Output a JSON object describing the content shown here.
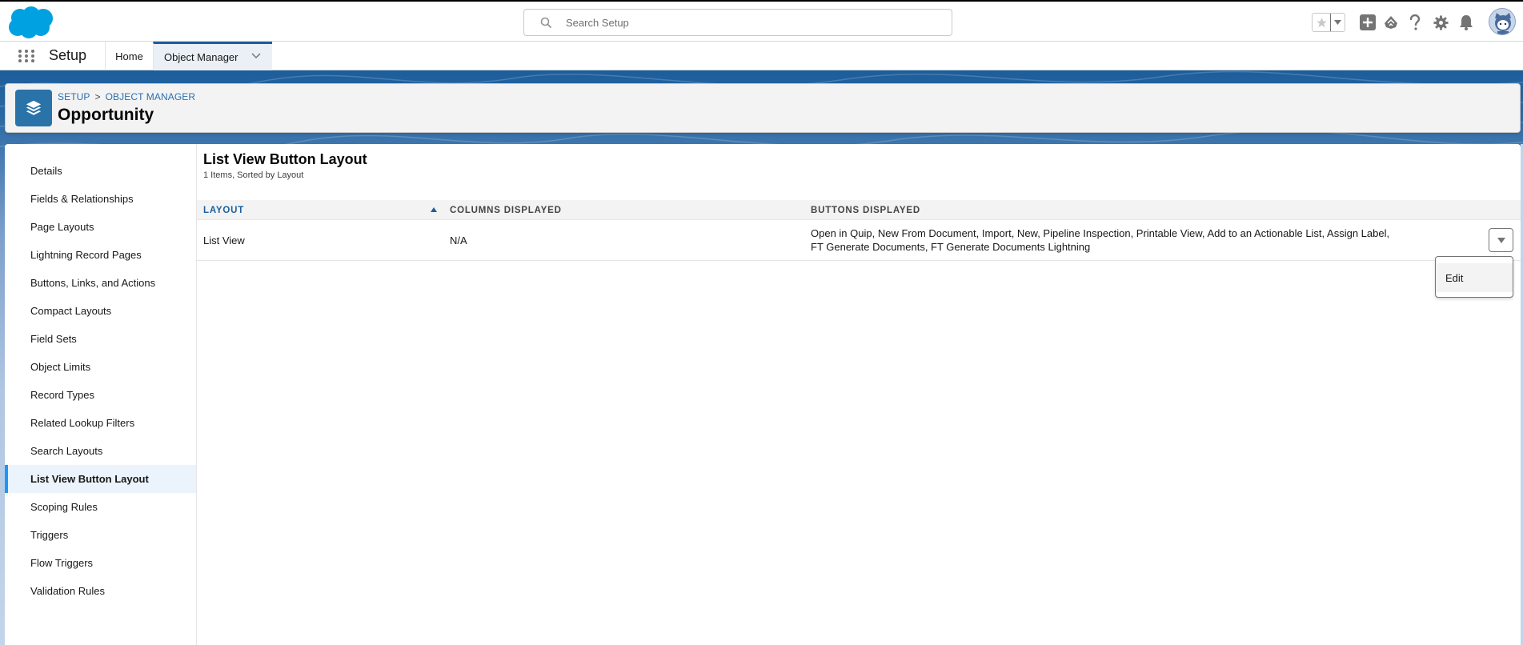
{
  "header": {
    "logo": "salesforce-cloud-logo",
    "search": {
      "placeholder": "Search Setup",
      "value": "",
      "icon": "search-icon"
    },
    "icons": [
      {
        "name": "favorites-star-icon"
      },
      {
        "name": "favorites-dropdown-icon"
      },
      {
        "name": "global-actions-add-icon"
      },
      {
        "name": "trailhead-guidance-icon"
      },
      {
        "name": "help-icon"
      },
      {
        "name": "setup-gear-icon"
      },
      {
        "name": "notifications-bell-icon"
      },
      {
        "name": "user-avatar"
      }
    ]
  },
  "nav": {
    "app_name": "Setup",
    "tabs": [
      {
        "label": "Home",
        "active": false
      },
      {
        "label": "Object Manager",
        "active": true,
        "has_menu": true
      }
    ]
  },
  "object_header": {
    "breadcrumb": [
      "SETUP",
      "OBJECT MANAGER"
    ],
    "breadcrumb_separator": ">",
    "title": "Opportunity",
    "icon": "layers-icon",
    "icon_color": "#2a73a9"
  },
  "sidebar": {
    "items": [
      {
        "label": "Details"
      },
      {
        "label": "Fields & Relationships"
      },
      {
        "label": "Page Layouts"
      },
      {
        "label": "Lightning Record Pages"
      },
      {
        "label": "Buttons, Links, and Actions"
      },
      {
        "label": "Compact Layouts"
      },
      {
        "label": "Field Sets"
      },
      {
        "label": "Object Limits"
      },
      {
        "label": "Record Types"
      },
      {
        "label": "Related Lookup Filters"
      },
      {
        "label": "Search Layouts"
      },
      {
        "label": "List View Button Layout",
        "active": true
      },
      {
        "label": "Scoping Rules"
      },
      {
        "label": "Triggers"
      },
      {
        "label": "Flow Triggers"
      },
      {
        "label": "Validation Rules"
      }
    ],
    "active_color": "#1b96ff"
  },
  "main": {
    "title": "List View Button Layout",
    "subtitle": "1 Items, Sorted by Layout",
    "table": {
      "columns": [
        {
          "label": "Layout",
          "sorted": "ascending"
        },
        {
          "label": "Columns Displayed"
        },
        {
          "label": "Buttons Displayed"
        }
      ],
      "rows": [
        {
          "layout": "List View",
          "columns_displayed": "N/A",
          "buttons_displayed_line1": "Open in Quip, New From Document, Import, New, Pipeline Inspection, Printable View, Add to an Actionable List, Assign Label,",
          "buttons_displayed_line2": "FT Generate Documents, FT Generate Documents Lightning"
        }
      ]
    },
    "row_menu": {
      "open": true,
      "items": [
        {
          "label": "Edit"
        }
      ]
    }
  },
  "colors": {
    "brand_blue": "#1b5f9e",
    "salesforce_cloud": "#00a1e0",
    "link": "#2a6fb0"
  }
}
